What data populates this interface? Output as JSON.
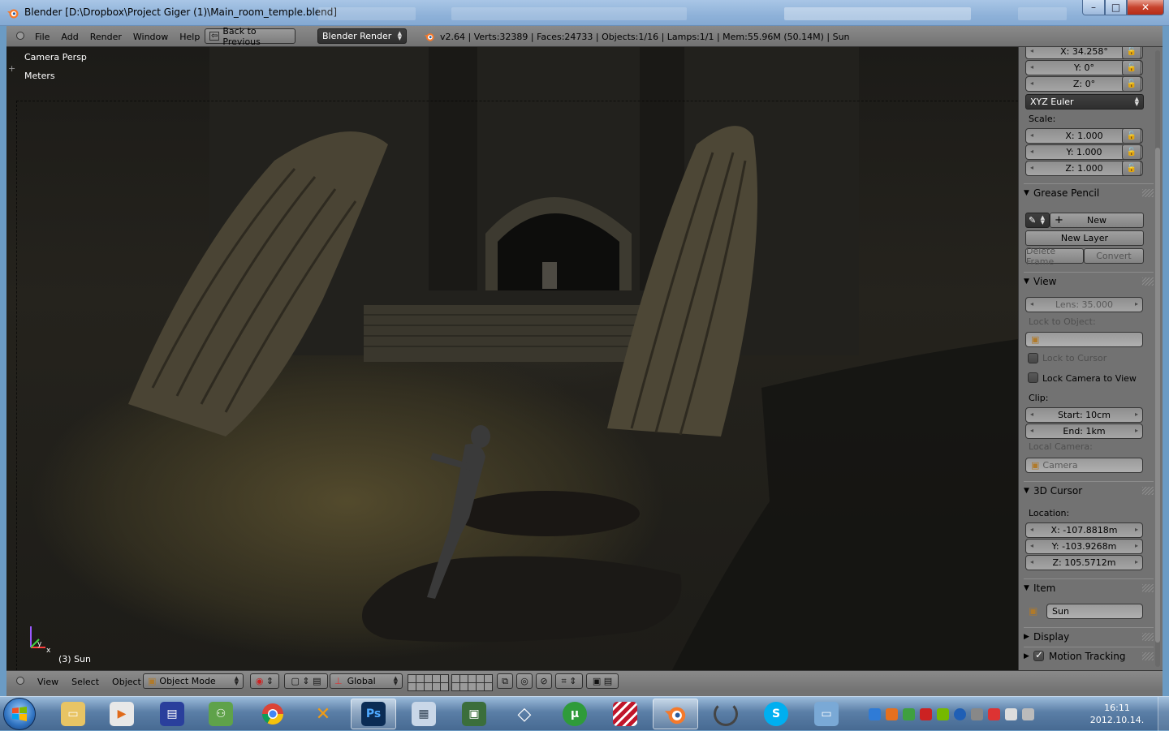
{
  "window": {
    "title": "Blender [D:\\Dropbox\\Project Giger (1)\\Main_room_temple.blend]",
    "controls": {
      "minimize": "–",
      "maximize": "□",
      "close": "✕"
    }
  },
  "info_header": {
    "menus": [
      "File",
      "Add",
      "Render",
      "Window",
      "Help"
    ],
    "back_button": "Back to Previous",
    "render_engine": "Blender Render",
    "stats": "v2.64 | Verts:32389 | Faces:24733 | Objects:1/16 | Lamps:1/1 | Mem:55.96M (50.14M) | Sun"
  },
  "viewport": {
    "view_name": "Camera Persp",
    "units": "Meters",
    "active_object": "(3) Sun",
    "axis_labels": {
      "y": "y",
      "x": "x",
      "z": "z"
    }
  },
  "properties_panel": {
    "rotation": {
      "x": "X: 34.258°",
      "y": "Y: 0°",
      "z": "Z: 0°",
      "mode": "XYZ Euler"
    },
    "scale": {
      "label": "Scale:",
      "x": "X: 1.000",
      "y": "Y: 1.000",
      "z": "Z: 1.000"
    },
    "grease_pencil": {
      "title": "Grease Pencil",
      "new": "New",
      "new_layer": "New Layer",
      "delete_frame": "Delete Frame",
      "convert": "Convert"
    },
    "view": {
      "title": "View",
      "lens": "Lens: 35.000",
      "lock_to_object": "Lock to Object:",
      "lock_to_cursor": "Lock to Cursor",
      "lock_camera": "Lock Camera to View",
      "clip": "Clip:",
      "clip_start": "Start: 10cm",
      "clip_end": "End: 1km",
      "local_camera": "Local Camera:",
      "camera_value": "Camera"
    },
    "cursor": {
      "title": "3D Cursor",
      "location": "Location:",
      "x": "X: -107.8818m",
      "y": "Y: -103.9268m",
      "z": "Z: 105.5712m"
    },
    "item": {
      "title": "Item",
      "name": "Sun"
    },
    "display": {
      "title": "Display"
    },
    "motion_tracking": {
      "title": "Motion Tracking",
      "checked": true
    }
  },
  "view3d_header": {
    "menus": [
      "View",
      "Select",
      "Object"
    ],
    "mode": "Object Mode",
    "orientation": "Global"
  },
  "taskbar": {
    "clock_time": "16:11",
    "clock_date": "2012.10.14.",
    "apps": [
      "explorer",
      "media-player",
      "save-disk",
      "network",
      "chrome",
      "xamp",
      "photoshop",
      "calculator",
      "system-monitor",
      "unity",
      "utorrent",
      "stripes-app",
      "blender",
      "loading",
      "skype",
      "photo-viewer"
    ]
  },
  "colors": {
    "blender_bg": "#727272",
    "header_text": "#000000",
    "viewport_floor": "#5c5230",
    "taskbar_blue": "#5a7da5"
  }
}
